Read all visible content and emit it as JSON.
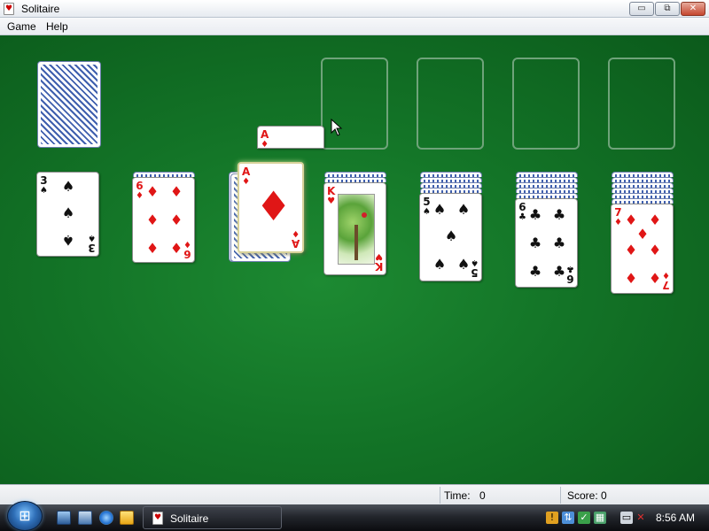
{
  "window": {
    "title": "Solitaire",
    "icon": "solitaire-app-icon",
    "controls": {
      "minimize": "▭",
      "maximize": "⧉",
      "close": "✕"
    }
  },
  "menu": {
    "game": "Game",
    "help": "Help"
  },
  "colors": {
    "felt": "#137427",
    "red_suit": "#e01616",
    "black_suit": "#111111",
    "card_back": "#3f5fae"
  },
  "board": {
    "stock": {
      "icon": "card-back-icon"
    },
    "dragged_card": {
      "rank": "A",
      "suit": "♦"
    },
    "waste_card": {
      "rank": "A",
      "suit": "♦"
    },
    "tableau": [
      {
        "rank": "3",
        "suit": "♠"
      },
      {
        "rank": "6",
        "suit": "♦"
      },
      {
        "rank": "",
        "suit": ""
      },
      {
        "rank": "K",
        "suit": "♥"
      },
      {
        "rank": "5",
        "suit": "♠"
      },
      {
        "rank": "6",
        "suit": "♣"
      },
      {
        "rank": "7",
        "suit": "♦"
      }
    ]
  },
  "status": {
    "time_label": "Time:",
    "time_value": "0",
    "score_label": "Score: 0"
  },
  "taskbar": {
    "task_label": "Solitaire",
    "clock": "8:56 AM"
  }
}
